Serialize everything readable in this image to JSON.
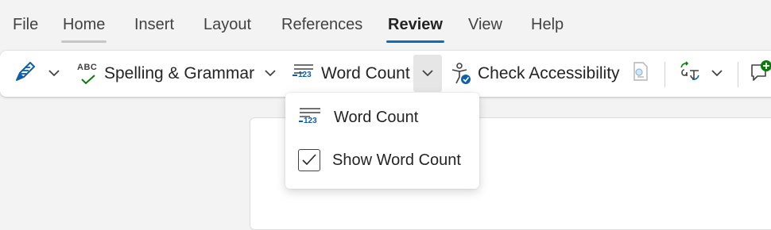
{
  "tabs": [
    {
      "label": "File",
      "active": false
    },
    {
      "label": "Home",
      "active": false
    },
    {
      "label": "Insert",
      "active": false
    },
    {
      "label": "Layout",
      "active": false
    },
    {
      "label": "References",
      "active": false
    },
    {
      "label": "Review",
      "active": true
    },
    {
      "label": "View",
      "active": false
    },
    {
      "label": "Help",
      "active": false
    }
  ],
  "ribbon": {
    "spelling_grammar": "Spelling & Grammar",
    "spelling_icon_text": "ABC",
    "word_count": "Word Count",
    "word_count_icon_text": "123",
    "check_accessibility": "Check Accessibility"
  },
  "dropdown": {
    "items": [
      {
        "label": "Word Count"
      },
      {
        "label": "Show Word Count",
        "checked": true
      }
    ]
  },
  "colors": {
    "accent": "#0f6cbd",
    "home_underline": "#c7c7c7",
    "icon_blue": "#115ea3",
    "green": "#0e7a0d"
  }
}
